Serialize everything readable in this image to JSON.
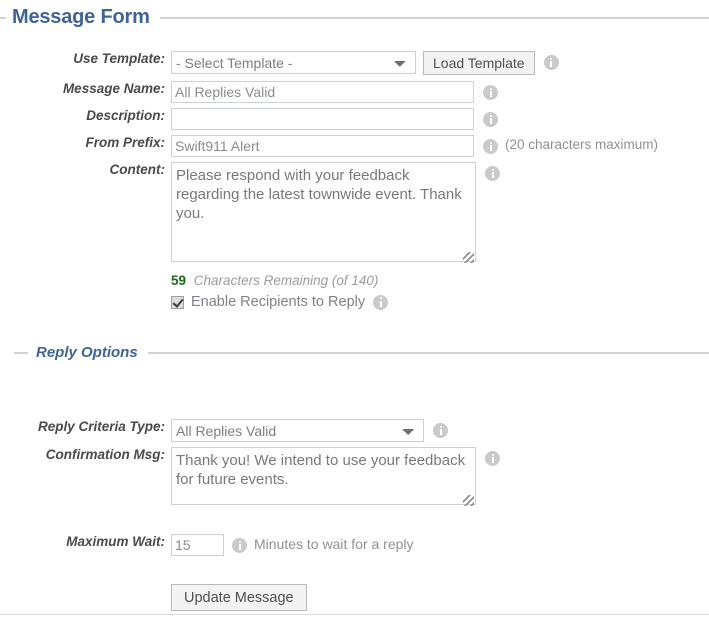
{
  "sections": {
    "message_form": {
      "legend": "Message Form",
      "fields": {
        "use_template": {
          "label": "Use Template:",
          "selected": "- Select Template -",
          "options": [
            "- Select Template -"
          ],
          "button_label": "Load Template"
        },
        "message_name": {
          "label": "Message Name:",
          "value": "All Replies Valid",
          "placeholder": ""
        },
        "description": {
          "label": "Description:",
          "value": "",
          "placeholder": ""
        },
        "from_prefix": {
          "label": "From Prefix:",
          "value": "Swift911 Alert",
          "placeholder": "",
          "hint": "(20 characters maximum)"
        },
        "content": {
          "label": "Content:",
          "value": "Please respond with your feedback regarding the latest townwide event. Thank you.",
          "placeholder": ""
        }
      },
      "counter": {
        "remaining": "59",
        "text": "Characters Remaining (of 140)"
      },
      "enable_reply": {
        "label": "Enable Recipients to Reply",
        "checked": true
      }
    },
    "reply_options": {
      "legend": "Reply Options",
      "fields": {
        "reply_criteria_type": {
          "label": "Reply Criteria Type:",
          "selected": "All Replies Valid",
          "options": [
            "All Replies Valid"
          ]
        },
        "confirmation_msg": {
          "label": "Confirmation Msg:",
          "value": "Thank you! We intend to use your feedback for future events.",
          "placeholder": ""
        },
        "maximum_wait": {
          "label": "Maximum Wait:",
          "value": "15",
          "placeholder": "",
          "hint": "Minutes to wait for a reply"
        }
      }
    }
  },
  "actions": {
    "update_message": "Update Message"
  },
  "icons": {
    "info": "info-icon",
    "dropdown": "chevron-down-icon",
    "checkmark": "check-icon",
    "resize": "resize-grip-icon"
  },
  "colors": {
    "legend_blue": "#3e6399",
    "counter_green": "#1b6b1b",
    "rule_gray": "#cfd2d6",
    "field_border": "#cdd0d4"
  }
}
